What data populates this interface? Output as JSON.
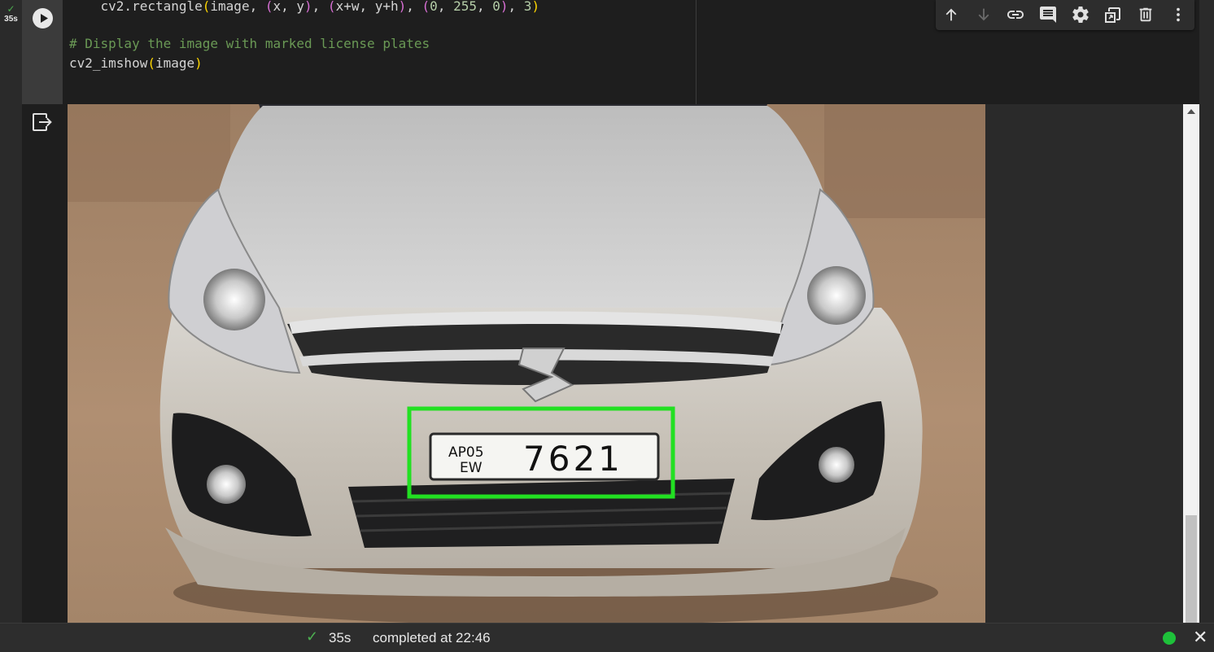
{
  "cell": {
    "exec_check": "✓",
    "exec_time": "35s",
    "code_lines": {
      "line1": {
        "pre": "    cv2.rectangle",
        "open": "(",
        "args1": "image, ",
        "p2o": "(",
        "xy": "x, y",
        "p2c": ")",
        "comma1": ", ",
        "p3o": "(",
        "xwyh": "x+w, y+h",
        "p3c": ")",
        "comma2": ", ",
        "p4o": "(",
        "n0": "0",
        "c3": ", ",
        "n255": "255",
        "c4": ", ",
        "n0b": "0",
        "p4c": ")",
        "comma5": ", ",
        "n3": "3",
        "close": ")"
      },
      "line2": "# Display the image with marked license plates",
      "line3": {
        "fn": "cv2_imshow",
        "open": "(",
        "arg": "image",
        "close": ")"
      }
    }
  },
  "toolbar": {
    "buttons": [
      "arrow-up-icon",
      "arrow-down-icon",
      "link-icon",
      "comment-icon",
      "gear-icon",
      "mirror-cell-icon",
      "trash-icon",
      "more-vert-icon"
    ]
  },
  "output": {
    "plate_text_top": "AP05",
    "plate_text_bottom": "EW",
    "plate_number": "7621",
    "rect_color": "#22e022"
  },
  "status": {
    "check": "✓",
    "time": "35s",
    "text": "completed at 22:46",
    "close": "✕",
    "dot_color": "#1ec13a"
  }
}
